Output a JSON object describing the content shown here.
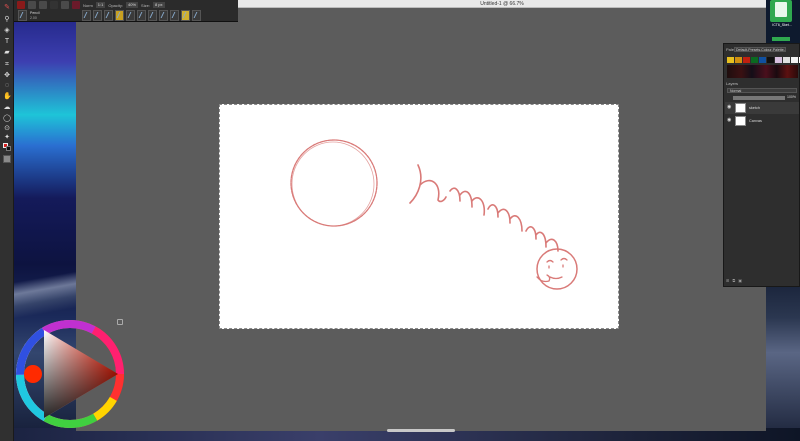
{
  "window": {
    "title": "Untitled-1 @ 66.7%"
  },
  "toolbar": {
    "blend_label": "Norm",
    "blend_value": "1:1",
    "opacity_label": "Opacity:",
    "opacity_value": "40%",
    "size_label": "Size:",
    "size_value": "8 px",
    "brush_name": "Pencil",
    "brush_size": "2.00"
  },
  "docker": {
    "palette_title": "Pale",
    "palette_name": "Default-Presets-Colour-Palette-Set",
    "layers_title": "Layers",
    "blend_mode": "Normal",
    "opacity": "100%",
    "layers": [
      {
        "name": "sketch"
      },
      {
        "name": "Canvas"
      }
    ],
    "swatch_colors": [
      "#e8c020",
      "#d09010",
      "#c02010",
      "#0a6a20",
      "#1050a0",
      "#101010",
      "#d8c0e0",
      "#e0e0e0",
      "#f4f4f4",
      "#ffffff"
    ]
  },
  "desktop": {
    "icon_label": "ICT6_Sket..."
  },
  "colors": {
    "foreground": "#d82020",
    "background": "#111111",
    "stroke": "#d97a78"
  }
}
